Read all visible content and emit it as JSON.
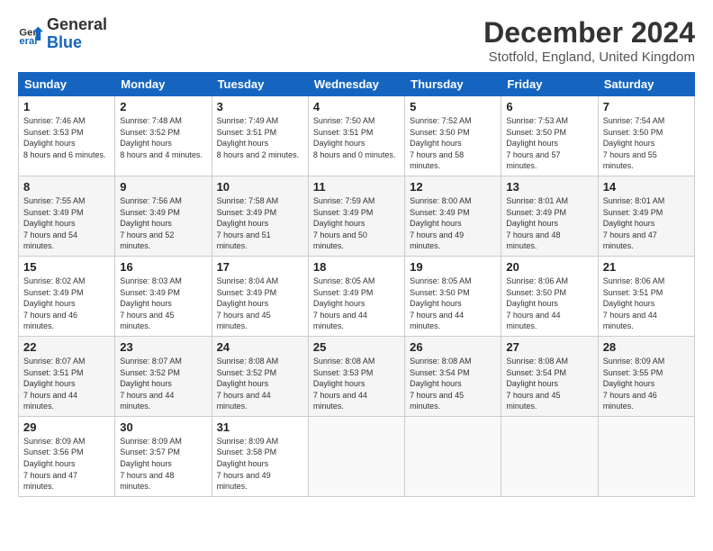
{
  "logo": {
    "line1": "General",
    "line2": "Blue"
  },
  "header": {
    "title": "December 2024",
    "subtitle": "Stotfold, England, United Kingdom"
  },
  "weekdays": [
    "Sunday",
    "Monday",
    "Tuesday",
    "Wednesday",
    "Thursday",
    "Friday",
    "Saturday"
  ],
  "weeks": [
    [
      {
        "day": "1",
        "sunrise": "7:46 AM",
        "sunset": "3:53 PM",
        "daylight": "8 hours and 6 minutes."
      },
      {
        "day": "2",
        "sunrise": "7:48 AM",
        "sunset": "3:52 PM",
        "daylight": "8 hours and 4 minutes."
      },
      {
        "day": "3",
        "sunrise": "7:49 AM",
        "sunset": "3:51 PM",
        "daylight": "8 hours and 2 minutes."
      },
      {
        "day": "4",
        "sunrise": "7:50 AM",
        "sunset": "3:51 PM",
        "daylight": "8 hours and 0 minutes."
      },
      {
        "day": "5",
        "sunrise": "7:52 AM",
        "sunset": "3:50 PM",
        "daylight": "7 hours and 58 minutes."
      },
      {
        "day": "6",
        "sunrise": "7:53 AM",
        "sunset": "3:50 PM",
        "daylight": "7 hours and 57 minutes."
      },
      {
        "day": "7",
        "sunrise": "7:54 AM",
        "sunset": "3:50 PM",
        "daylight": "7 hours and 55 minutes."
      }
    ],
    [
      {
        "day": "8",
        "sunrise": "7:55 AM",
        "sunset": "3:49 PM",
        "daylight": "7 hours and 54 minutes."
      },
      {
        "day": "9",
        "sunrise": "7:56 AM",
        "sunset": "3:49 PM",
        "daylight": "7 hours and 52 minutes."
      },
      {
        "day": "10",
        "sunrise": "7:58 AM",
        "sunset": "3:49 PM",
        "daylight": "7 hours and 51 minutes."
      },
      {
        "day": "11",
        "sunrise": "7:59 AM",
        "sunset": "3:49 PM",
        "daylight": "7 hours and 50 minutes."
      },
      {
        "day": "12",
        "sunrise": "8:00 AM",
        "sunset": "3:49 PM",
        "daylight": "7 hours and 49 minutes."
      },
      {
        "day": "13",
        "sunrise": "8:01 AM",
        "sunset": "3:49 PM",
        "daylight": "7 hours and 48 minutes."
      },
      {
        "day": "14",
        "sunrise": "8:01 AM",
        "sunset": "3:49 PM",
        "daylight": "7 hours and 47 minutes."
      }
    ],
    [
      {
        "day": "15",
        "sunrise": "8:02 AM",
        "sunset": "3:49 PM",
        "daylight": "7 hours and 46 minutes."
      },
      {
        "day": "16",
        "sunrise": "8:03 AM",
        "sunset": "3:49 PM",
        "daylight": "7 hours and 45 minutes."
      },
      {
        "day": "17",
        "sunrise": "8:04 AM",
        "sunset": "3:49 PM",
        "daylight": "7 hours and 45 minutes."
      },
      {
        "day": "18",
        "sunrise": "8:05 AM",
        "sunset": "3:49 PM",
        "daylight": "7 hours and 44 minutes."
      },
      {
        "day": "19",
        "sunrise": "8:05 AM",
        "sunset": "3:50 PM",
        "daylight": "7 hours and 44 minutes."
      },
      {
        "day": "20",
        "sunrise": "8:06 AM",
        "sunset": "3:50 PM",
        "daylight": "7 hours and 44 minutes."
      },
      {
        "day": "21",
        "sunrise": "8:06 AM",
        "sunset": "3:51 PM",
        "daylight": "7 hours and 44 minutes."
      }
    ],
    [
      {
        "day": "22",
        "sunrise": "8:07 AM",
        "sunset": "3:51 PM",
        "daylight": "7 hours and 44 minutes."
      },
      {
        "day": "23",
        "sunrise": "8:07 AM",
        "sunset": "3:52 PM",
        "daylight": "7 hours and 44 minutes."
      },
      {
        "day": "24",
        "sunrise": "8:08 AM",
        "sunset": "3:52 PM",
        "daylight": "7 hours and 44 minutes."
      },
      {
        "day": "25",
        "sunrise": "8:08 AM",
        "sunset": "3:53 PM",
        "daylight": "7 hours and 44 minutes."
      },
      {
        "day": "26",
        "sunrise": "8:08 AM",
        "sunset": "3:54 PM",
        "daylight": "7 hours and 45 minutes."
      },
      {
        "day": "27",
        "sunrise": "8:08 AM",
        "sunset": "3:54 PM",
        "daylight": "7 hours and 45 minutes."
      },
      {
        "day": "28",
        "sunrise": "8:09 AM",
        "sunset": "3:55 PM",
        "daylight": "7 hours and 46 minutes."
      }
    ],
    [
      {
        "day": "29",
        "sunrise": "8:09 AM",
        "sunset": "3:56 PM",
        "daylight": "7 hours and 47 minutes."
      },
      {
        "day": "30",
        "sunrise": "8:09 AM",
        "sunset": "3:57 PM",
        "daylight": "7 hours and 48 minutes."
      },
      {
        "day": "31",
        "sunrise": "8:09 AM",
        "sunset": "3:58 PM",
        "daylight": "7 hours and 49 minutes."
      },
      null,
      null,
      null,
      null
    ]
  ]
}
